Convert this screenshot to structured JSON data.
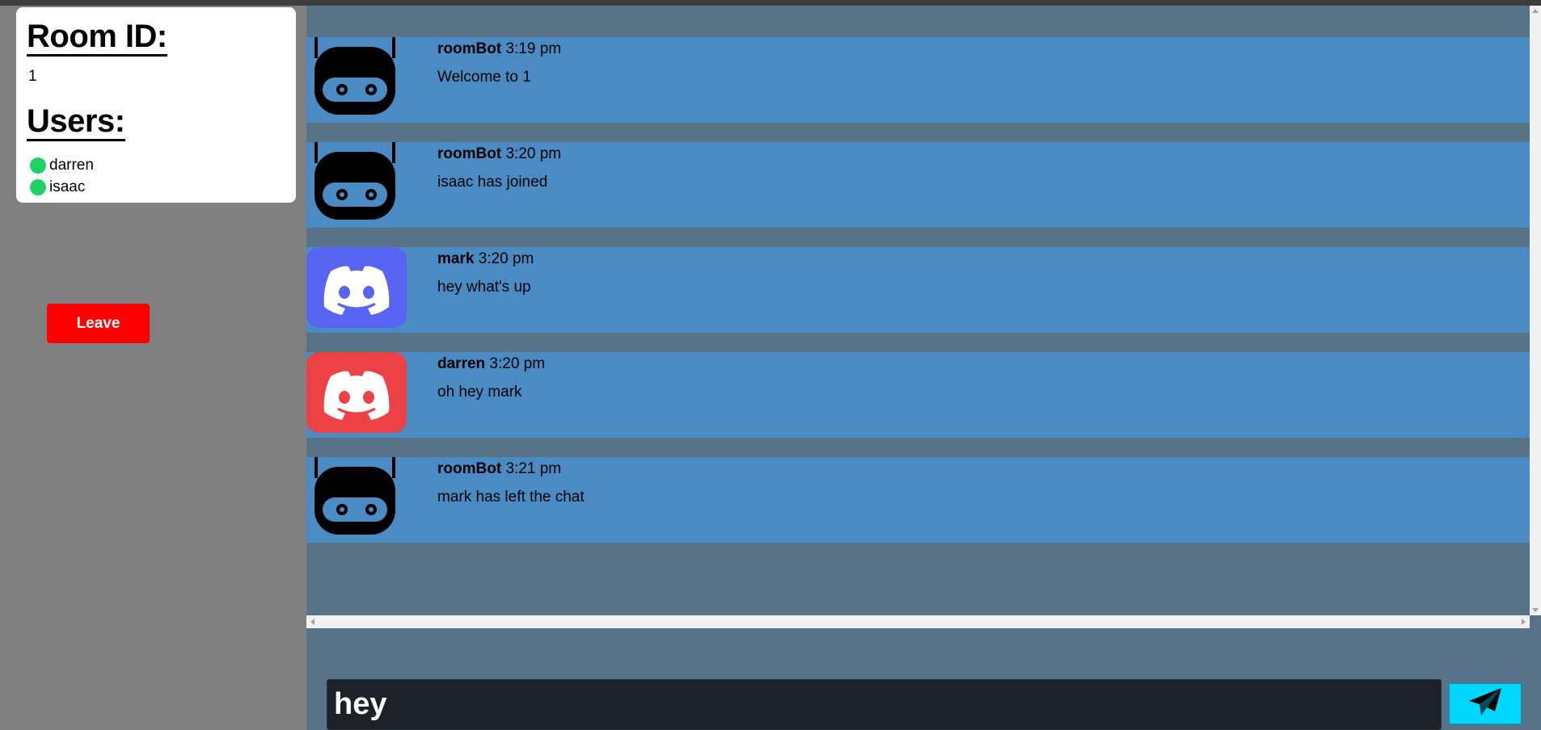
{
  "sidebar": {
    "room_heading": "Room ID:",
    "room_id": "1",
    "users_heading": "Users:",
    "users": [
      {
        "name": "darren",
        "status_color": "#20d266"
      },
      {
        "name": "isaac",
        "status_color": "#20d266"
      }
    ],
    "leave_label": "Leave"
  },
  "messages": [
    {
      "user": "roomBot",
      "time": "3:19 pm",
      "text": "Welcome to 1",
      "avatar": "robot-icon"
    },
    {
      "user": "roomBot",
      "time": "3:20 pm",
      "text": "isaac has joined",
      "avatar": "robot-icon"
    },
    {
      "user": "mark",
      "time": "3:20 pm",
      "text": "hey what's up",
      "avatar": "discord-icon",
      "avatar_color": "#5865f2"
    },
    {
      "user": "darren",
      "time": "3:20 pm",
      "text": "oh hey mark",
      "avatar": "discord-icon",
      "avatar_color": "#ed4245"
    },
    {
      "user": "roomBot",
      "time": "3:21 pm",
      "text": "mark has left the chat",
      "avatar": "robot-icon"
    }
  ],
  "composer": {
    "value": "hey",
    "send_icon": "send-icon"
  },
  "colors": {
    "sidebar_bg": "#808080",
    "chat_bg": "#587287",
    "message_bg": "#4a8bc4",
    "leave_button": "#ff0000",
    "send_button": "#00d7ff",
    "input_bg": "#1d2228"
  }
}
